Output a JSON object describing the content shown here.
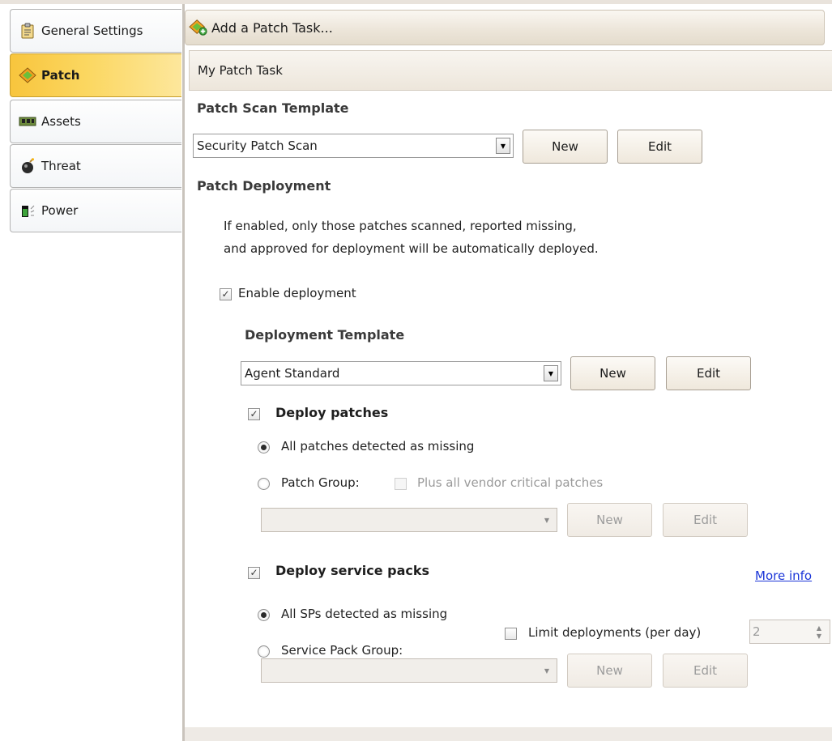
{
  "sidebar": {
    "items": [
      {
        "label": "General Settings",
        "icon": "clipboard-icon",
        "active": false
      },
      {
        "label": "Patch",
        "icon": "patch-diamond-icon",
        "active": true
      },
      {
        "label": "Assets",
        "icon": "assets-chip-icon",
        "active": false
      },
      {
        "label": "Threat",
        "icon": "bomb-icon",
        "active": false
      },
      {
        "label": "Power",
        "icon": "power-icon",
        "active": false
      }
    ]
  },
  "header": {
    "add_task_label": "Add a Patch Task...",
    "icon": "add-patch-icon"
  },
  "task": {
    "name": "My Patch Task"
  },
  "scan": {
    "heading": "Patch Scan Template",
    "template_value": "Security Patch Scan",
    "new_label": "New",
    "edit_label": "Edit"
  },
  "deployment": {
    "heading": "Patch Deployment",
    "description_line1": "If enabled, only those patches scanned, reported missing,",
    "description_line2": "and approved for deployment will be automatically deployed.",
    "enable_label": "Enable deployment",
    "enable_checked": true,
    "template_heading": "Deployment Template",
    "template_value": "Agent Standard",
    "new_label": "New",
    "edit_label": "Edit"
  },
  "patches": {
    "deploy_label": "Deploy patches",
    "deploy_checked": true,
    "all_label": "All patches detected as missing",
    "group_label": "Patch Group:",
    "vendor_label": "Plus all vendor critical patches",
    "group_value": "",
    "new_label": "New",
    "edit_label": "Edit"
  },
  "service_packs": {
    "deploy_label": "Deploy service packs",
    "deploy_checked": true,
    "more_info": "More info",
    "all_label": "All SPs detected as missing",
    "group_label": "Service Pack Group:",
    "limit_label": "Limit deployments (per day)",
    "limit_value": "2",
    "group_value": "",
    "new_label": "New",
    "edit_label": "Edit"
  },
  "colors": {
    "active_tab": "#f8c53d",
    "link": "#1a35d8",
    "header_bg": "#ede6da"
  }
}
